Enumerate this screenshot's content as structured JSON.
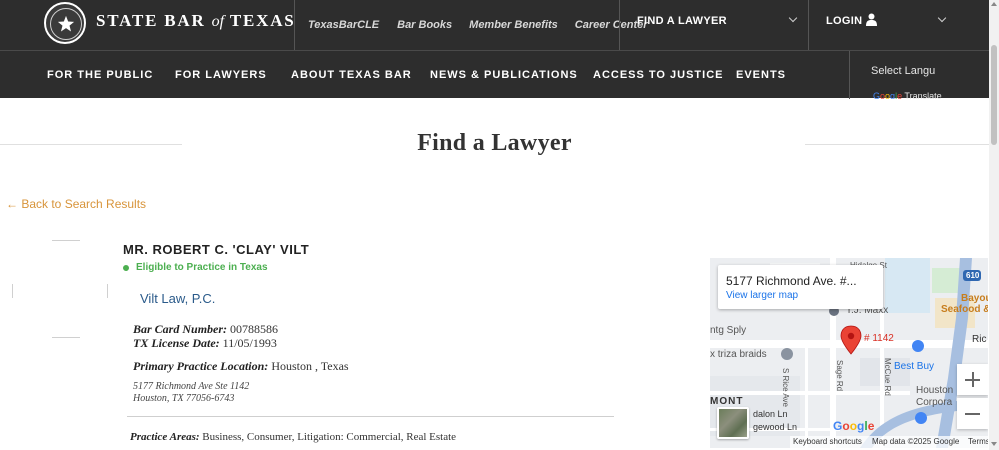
{
  "header": {
    "logo_text_1": "STATE BAR",
    "logo_text_of": "of",
    "logo_text_2": "TEXAS",
    "utility_links": [
      "TexasBarCLE",
      "Bar Books",
      "Member Benefits",
      "Career Center"
    ],
    "find_lawyer": "FIND A LAWYER",
    "login": "LOGIN"
  },
  "nav": {
    "items": [
      "FOR THE PUBLIC",
      "FOR LAWYERS",
      "ABOUT TEXAS BAR",
      "NEWS & PUBLICATIONS",
      "ACCESS TO JUSTICE",
      "EVENTS"
    ],
    "language_select": "Select Language",
    "translate_label": "Translate"
  },
  "page": {
    "title": "Find a Lawyer",
    "back_link": "← Back to Search Results"
  },
  "profile": {
    "name": "MR. ROBERT C. 'CLAY' VILT",
    "status": "Eligible to Practice in Texas",
    "firm": "Vilt Law, P.C.",
    "bar_card_label": "Bar Card Number:",
    "bar_card_value": "00788586",
    "license_label": "TX License Date:",
    "license_value": "11/05/1993",
    "location_label": "Primary Practice Location:",
    "location_value": "Houston , Texas",
    "address_line1": "5177 Richmond Ave Ste 1142",
    "address_line2": "Houston, TX 77056-6743",
    "practice_label": "Practice Areas:",
    "practice_value": "Business, Consumer, Litigation: Commercial, Real Estate"
  },
  "map": {
    "address": "5177 Richmond Ave. #...",
    "view_larger": "View larger map",
    "pin_label": "# 1142",
    "labels": {
      "hidalgo": "Hidalgo St",
      "tj_maxx": "T.J. Maxx",
      "bayou": "Bayou",
      "seafood": "Seafood &",
      "rich": "Ric",
      "tgtsply": "ntg Sply",
      "triza": "x triza braids",
      "best_buy": "Best Buy",
      "houston": "Houston",
      "corpora": "Corpora",
      "mont": "MONT",
      "dalon": "dalon Ln",
      "gewood": "gewood Ln",
      "rice_ave": "S Rice Ave",
      "sage_rd": "Sage Rd",
      "mccue_rd": "McCue Rd",
      "hwy": "610"
    },
    "google": "Google",
    "shortcuts": "Keyboard shortcuts",
    "map_data": "Map data ©2025 Google",
    "terms": "Terms"
  },
  "colors": {
    "header_bg": "#2d2d2d",
    "accent_gold": "#d8943a",
    "eligible_green": "#4caf50",
    "firm_blue": "#2a5a8a",
    "pin_red": "#ea4335"
  }
}
